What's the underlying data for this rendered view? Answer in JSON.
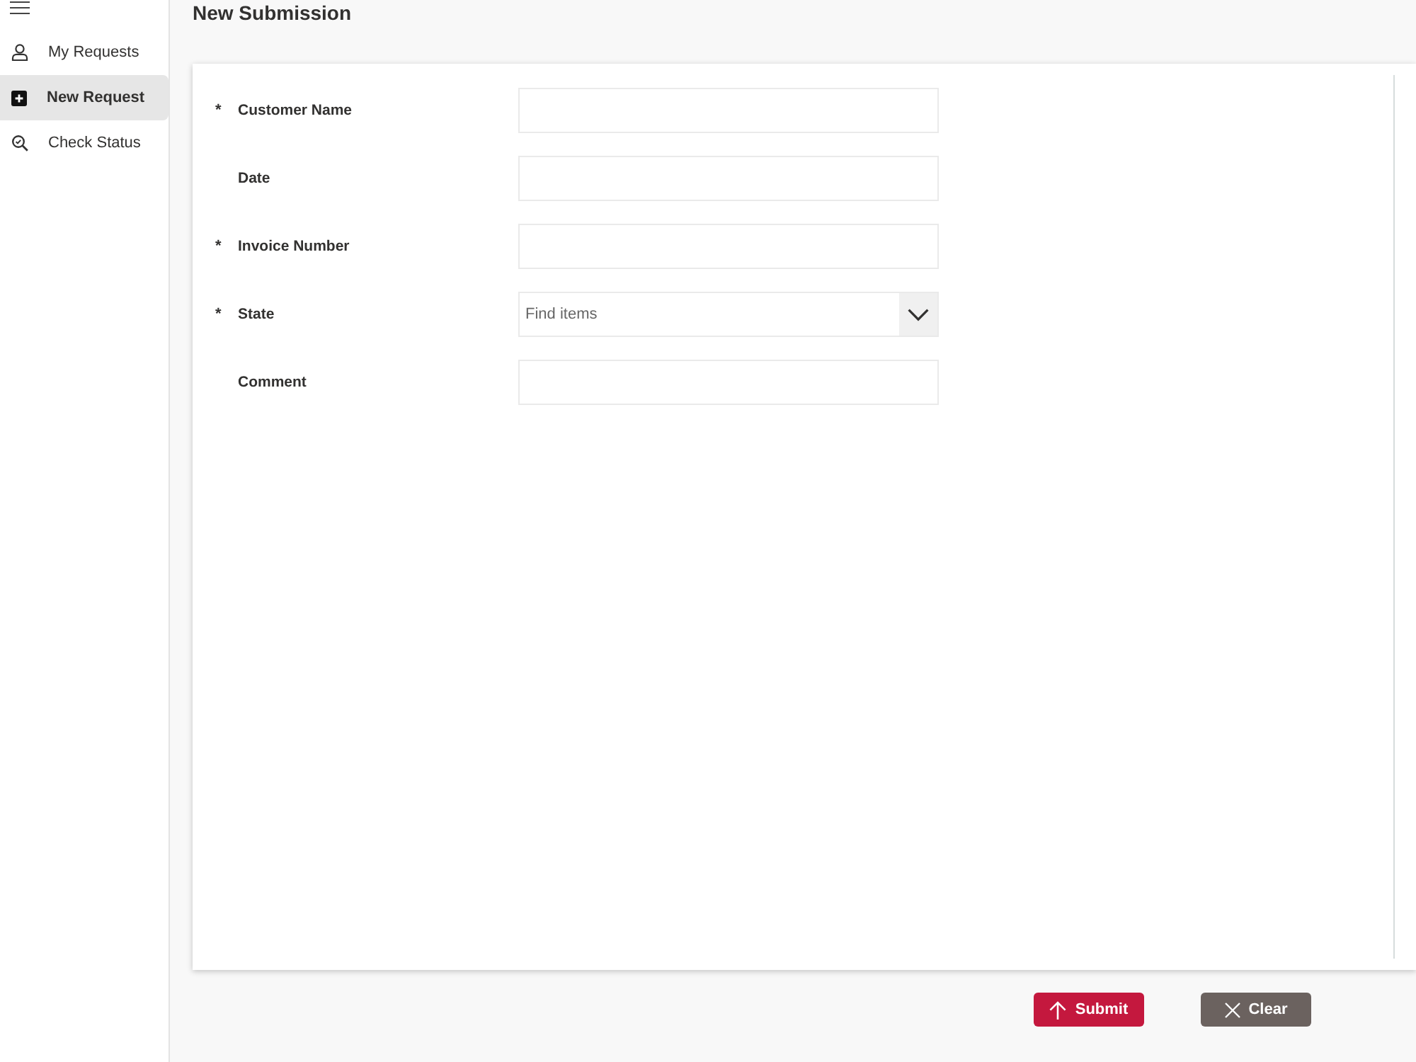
{
  "sidebar": {
    "items": [
      {
        "label": "My Requests",
        "selected": false
      },
      {
        "label": "New Request",
        "selected": true
      },
      {
        "label": "Check Status",
        "selected": false
      }
    ]
  },
  "page": {
    "title": "New Submission"
  },
  "form": {
    "fields": [
      {
        "label": "Customer Name",
        "required_mark": "*",
        "kind": "text"
      },
      {
        "label": "Date",
        "kind": "text"
      },
      {
        "label": "Invoice Number",
        "required_mark": "*",
        "kind": "text"
      },
      {
        "label": "State",
        "required_mark": "*",
        "kind": "dropdown",
        "placeholder": "Find items"
      },
      {
        "label": "Comment",
        "kind": "text"
      }
    ]
  },
  "buttons": [
    {
      "label": "Submit",
      "kind": "primary"
    },
    {
      "label": "Clear",
      "kind": "secondary"
    }
  ]
}
